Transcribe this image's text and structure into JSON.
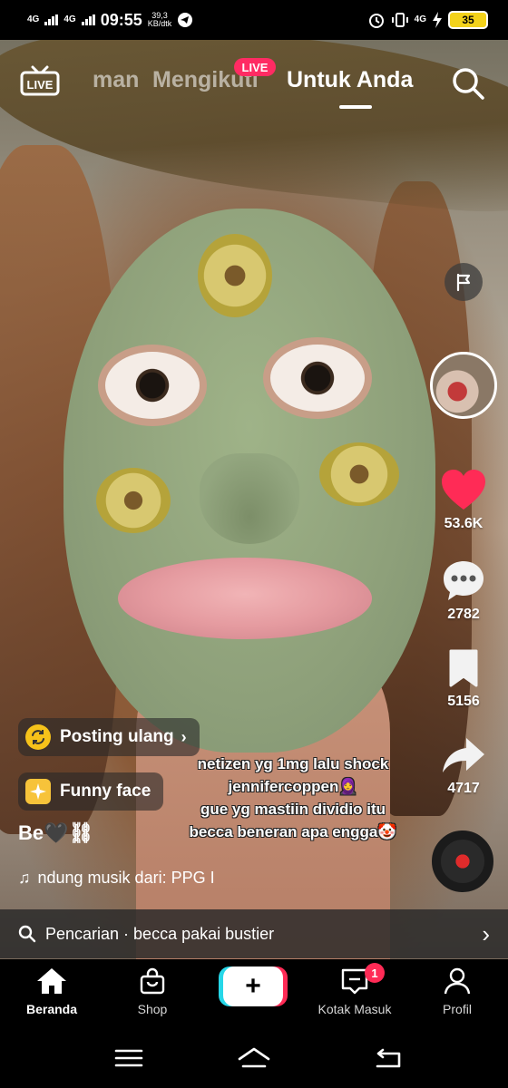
{
  "status_bar": {
    "network1": "4G",
    "network2": "4G",
    "time": "09:55",
    "speed_value": "39,3",
    "speed_unit": "KB/dtk",
    "network3": "4G",
    "battery": "35"
  },
  "top_nav": {
    "tab_partial": "man",
    "tab_following": "Mengikuti",
    "tab_for_you": "Untuk Anda",
    "live_badge": "LIVE"
  },
  "rail": {
    "likes": "53.6K",
    "comments": "2782",
    "saves": "5156",
    "shares": "4717",
    "like_color": "#ff2b56"
  },
  "caption": {
    "repost_label": "Posting ulang",
    "effect_label": "Funny face",
    "username": "Be🖤⛓",
    "music": "ndung musik dari: PPG I",
    "overlay_lines": [
      "netizen yg 1mg lalu shock",
      "jennifercoppen🧕",
      "gue yg mastiin dividio itu",
      "becca beneran apa engga🤡"
    ]
  },
  "search_bar": {
    "text": "Pencarian · becca pakai bustier"
  },
  "bottom_nav": {
    "home": "Beranda",
    "shop": "Shop",
    "inbox": "Kotak Masuk",
    "inbox_badge": "1",
    "profile": "Profil",
    "plus": "+"
  },
  "icons": {
    "live": "live-tv-icon",
    "search": "search-icon",
    "flag": "flag-icon",
    "heart": "heart-icon",
    "comment": "comment-icon",
    "bookmark": "bookmark-icon",
    "share": "share-icon",
    "music_note": "music-note-icon"
  }
}
